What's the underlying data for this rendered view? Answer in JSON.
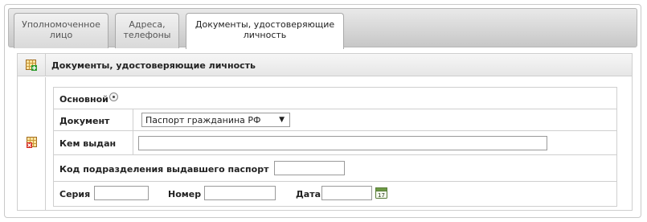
{
  "tabs": [
    {
      "label_line1": "Уполномоченное",
      "label_line2": "лицо"
    },
    {
      "label_line1": "Адреса,",
      "label_line2": "телефоны"
    },
    {
      "label_line1": "Документы, удостоверяющие",
      "label_line2": "личность"
    }
  ],
  "panel": {
    "title": "Документы, удостоверяющие личность",
    "add_icon": "table-add-icon",
    "remove_icon": "table-delete-icon"
  },
  "form": {
    "main_label": "Основной",
    "document_label": "Документ",
    "document_value": "Паспорт гражданина РФ",
    "issued_by_label": "Кем выдан",
    "issued_by_value": "",
    "division_code_label": "Код подразделения выдавшего паспорт",
    "division_code_value": "",
    "series_label": "Серия",
    "series_value": "",
    "number_label": "Номер",
    "number_value": "",
    "date_label": "Дата",
    "date_value": "",
    "calendar_icon": "calendar-icon",
    "calendar_day": "17"
  }
}
